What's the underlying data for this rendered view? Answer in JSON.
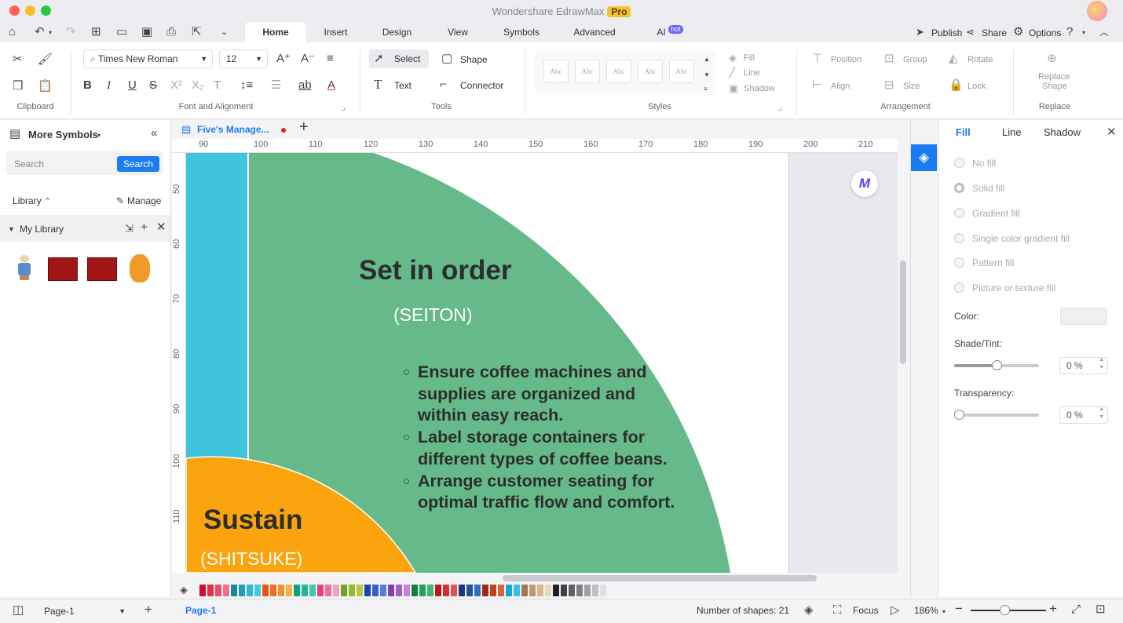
{
  "app": {
    "title": "Wondershare EdrawMax",
    "badge": "Pro"
  },
  "tabs": [
    {
      "label": "Home"
    },
    {
      "label": "Insert"
    },
    {
      "label": "Design"
    },
    {
      "label": "View"
    },
    {
      "label": "Symbols"
    },
    {
      "label": "Advanced"
    },
    {
      "label": "AI"
    }
  ],
  "ai_badge": "hot",
  "topright": {
    "publish": "Publish",
    "share": "Share",
    "options": "Options"
  },
  "ribbon": {
    "font_family": "Times New Roman",
    "font_size": "12",
    "select": "Select",
    "shape": "Shape",
    "text": "Text",
    "connector": "Connector",
    "style_preview": "Abc",
    "fill": "Fill",
    "line": "Line",
    "shadow": "Shadow",
    "position": "Position",
    "group": "Group",
    "rotate": "Rotate",
    "align": "Align",
    "size": "Size",
    "lock": "Lock",
    "replace_shape_1": "Replace",
    "replace_shape_2": "Shape",
    "groups": {
      "clipboard": "Clipboard",
      "font": "Font and Alignment",
      "tools": "Tools",
      "styles": "Styles",
      "arrangement": "Arrangement",
      "replace": "Replace"
    }
  },
  "left": {
    "more_symbols": "More Symbols",
    "search_placeholder": "Search",
    "search_button": "Search",
    "library": "Library",
    "manage": "Manage",
    "my_library": "My Library"
  },
  "doc_tab": "Five's Manage...",
  "ruler": {
    "h": [
      "90",
      "100",
      "110",
      "120",
      "130",
      "140",
      "150",
      "160",
      "170",
      "180",
      "190",
      "200",
      "210"
    ],
    "v": [
      "50",
      "60",
      "70",
      "80",
      "90",
      "100",
      "110"
    ]
  },
  "diagram": {
    "green_title": "Set in order",
    "green_sub": "(SEITON)",
    "bullets": [
      "Ensure coffee machines and supplies are organized and within easy reach.",
      "Label storage containers for different types of coffee beans.",
      "Arrange customer seating for optimal traffic flow and comfort."
    ],
    "orange_title": "Sustain",
    "orange_sub": "(SHITSUKE)",
    "colors": {
      "green": "#66ba89",
      "cyan": "#3ec4dd",
      "orange": "#fba40d"
    }
  },
  "right": {
    "tabs": [
      "Fill",
      "Line",
      "Shadow"
    ],
    "options": [
      "No fill",
      "Solid fill",
      "Gradient fill",
      "Single color gradient fill",
      "Pattern fill",
      "Picture or texture fill"
    ],
    "color_label": "Color:",
    "shade_label": "Shade/Tint:",
    "shade_value": "0 %",
    "transparency_label": "Transparency:",
    "transparency_value": "0 %"
  },
  "status": {
    "page_select": "Page-1",
    "page_tab": "Page-1",
    "shapes": "Number of shapes: 21",
    "focus": "Focus",
    "zoom": "186%"
  },
  "palette_colors": [
    "#c8102e",
    "#e0304a",
    "#e8506a",
    "#f07090",
    "#1a8a9a",
    "#20a0b4",
    "#30b8cc",
    "#48c8dc",
    "#f05010",
    "#f07020",
    "#f49030",
    "#f8b040",
    "#10a080",
    "#20b898",
    "#40c8b0",
    "#e8407a",
    "#f070a0",
    "#f4a0c0",
    "#78a020",
    "#98b830",
    "#b8c840",
    "#2040b0",
    "#3060c8",
    "#5080d8",
    "#8040b0",
    "#a060c8",
    "#c080e0",
    "#108040",
    "#20a058",
    "#40b870",
    "#c01818",
    "#d83030",
    "#e85050",
    "#183880",
    "#2050a0",
    "#3070c0",
    "#a02810",
    "#c04020",
    "#d86040",
    "#10a8d0",
    "#30c0e8",
    "#a07850",
    "#c09870",
    "#d8b890",
    "#e8d8c0",
    "#202020",
    "#404040",
    "#606060",
    "#808080",
    "#a0a0a0",
    "#c0c0c0",
    "#e0e0e0"
  ]
}
